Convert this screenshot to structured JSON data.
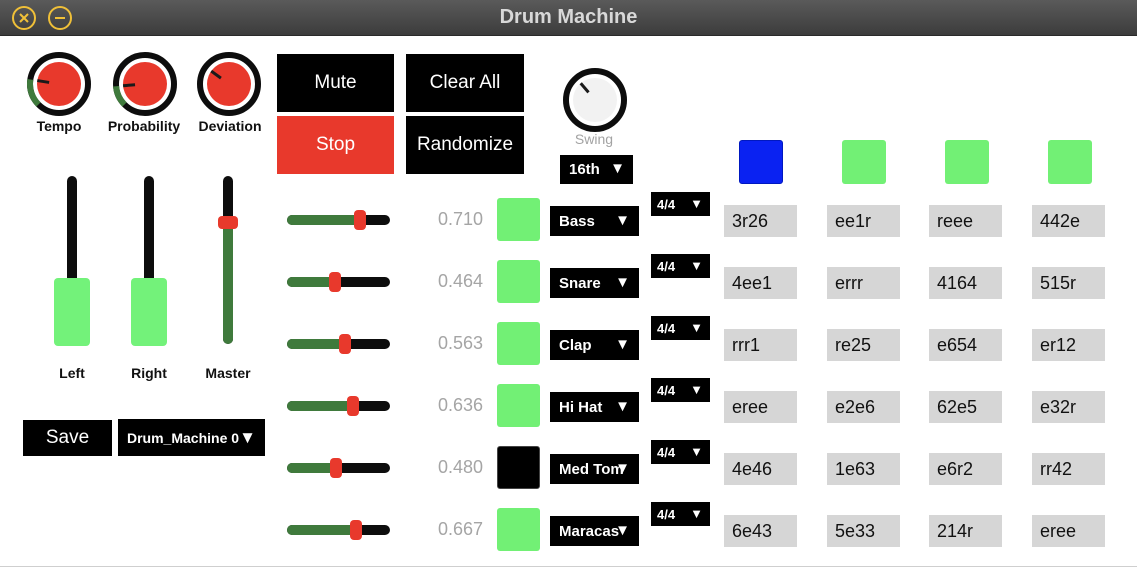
{
  "window": {
    "title": "Drum Machine"
  },
  "knobs": [
    {
      "label": "Tempo",
      "value": 0.2
    },
    {
      "label": "Probability",
      "value": 0.15
    },
    {
      "label": "Deviation",
      "value": 0.3
    }
  ],
  "faders": [
    {
      "label": "Left",
      "level": 0.28
    },
    {
      "label": "Right",
      "level": 0.28
    },
    {
      "label": "Master",
      "level": 0.75
    }
  ],
  "buttons": {
    "mute": "Mute",
    "stop": "Stop",
    "clear_all": "Clear All",
    "randomize": "Randomize",
    "save": "Save"
  },
  "preset": {
    "selected": "Drum_Machine 0"
  },
  "swing": {
    "label": "Swing",
    "value": 0.35,
    "division": "16th"
  },
  "colors": {
    "red": "#e8392c",
    "green": "#72f075",
    "dark_green": "#3f7a3c",
    "blue": "#0a22f2",
    "black": "#000000"
  },
  "step_indicators": [
    {
      "state": "active"
    },
    {
      "state": "on"
    },
    {
      "state": "on"
    },
    {
      "state": "on"
    }
  ],
  "tracks": [
    {
      "value": "0.710",
      "level": 0.71,
      "pad": "on",
      "instrument": "Bass",
      "meter": "4/4",
      "patterns": [
        "3r26",
        "ee1r",
        "reee",
        "442e"
      ]
    },
    {
      "value": "0.464",
      "level": 0.464,
      "pad": "on",
      "instrument": "Snare",
      "meter": "4/4",
      "patterns": [
        "4ee1",
        "errr",
        "4164",
        "515r"
      ]
    },
    {
      "value": "0.563",
      "level": 0.563,
      "pad": "on",
      "instrument": "Clap",
      "meter": "4/4",
      "patterns": [
        "rrr1",
        "re25",
        "e654",
        "er12"
      ]
    },
    {
      "value": "0.636",
      "level": 0.636,
      "pad": "on",
      "instrument": "Hi Hat",
      "meter": "4/4",
      "patterns": [
        "eree",
        "e2e6",
        "62e5",
        "e32r"
      ]
    },
    {
      "value": "0.480",
      "level": 0.48,
      "pad": "off",
      "instrument": "Med Tom",
      "meter": "4/4",
      "patterns": [
        "4e46",
        "1e63",
        "e6r2",
        "rr42"
      ]
    },
    {
      "value": "0.667",
      "level": 0.667,
      "pad": "on",
      "instrument": "Maracas",
      "meter": "4/4",
      "patterns": [
        "6e43",
        "5e33",
        "214r",
        "eree"
      ]
    }
  ]
}
